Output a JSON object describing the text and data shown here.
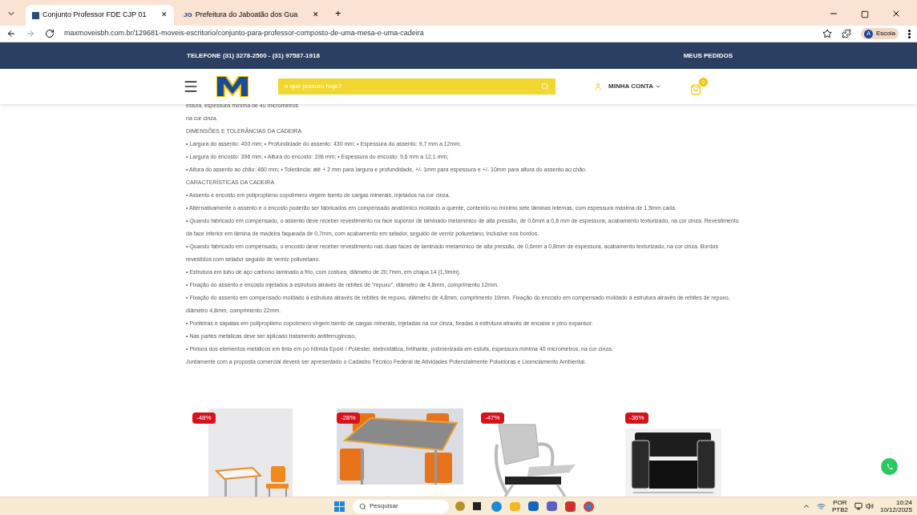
{
  "browser": {
    "tabs": [
      {
        "title": "Conjunto Professor FDE CJP 01",
        "close": "✕",
        "selected": true
      },
      {
        "favicon": "JG",
        "title": "Prefeitura do Jaboatão dos Gua",
        "close": "✕",
        "selected": false
      }
    ],
    "new_tab": "+",
    "url": "maxmoveisbh.com.br/129681-moveis-escritorio/conjunto-para-professor-composto-de-uma-mesa-e-uma-cadeira",
    "profile": {
      "initial": "A",
      "name": "Escola"
    }
  },
  "top_bar": {
    "phone": "TELEFONE (31) 3278-2500 - (31) 97587-1918",
    "orders": "MEUS PEDIDOS"
  },
  "header": {
    "search_placeholder": "o que procuro hoje?",
    "account": "MINHA CONTA",
    "cart_count": "0"
  },
  "description": [
    "estufa, espessura mínima de 40 micrometros",
    "na cor cinza.",
    "DIMENSÕES E TOLERÂNCIAS DA CADEIRA",
    "• Largura do assento: 400 mm; • Profundidade do assento: 430 mm; • Espessura do assento: 9,7 mm a 12mm;",
    "• Largura do encosto: 396 mm; • Altura do encosto: 198 mm; • Espessura do encosto: 9,6 mm a 12,1 mm;",
    "• Altura do assento ao chão: 460 mm; • Tolerância: até + 2 mm para largura e profundidade, +/- 1mm para espessura e +/- 10mm para altura do assento ao chão.",
    "CARACTERÍSTICAS DA CADEIRA",
    "• Assento e encosto em polipropileno copolímero virgem isento de cargas minerais, injetados na cor cinza.",
    "• Alternativamente o assento e o encosto poderão ser fabricados em compensado anatômico moldado a quente, contendo no mínimo sete lâminas internas, com espessura máxima de 1,5mm cada.",
    "• Quando fabricado em compensado, o assento deve receber revestimento na face superior de laminado melamínico de alta pressão, de 0,6mm a 0,8 mm de espessura, acabamento texturizado, na cor cinza. Revestimento da face inferior em lâmina de madeira faqueada de 0,7mm, com acabamento em selador, seguido de verniz poliuretano, inclusive nos bordos.",
    "• Quando fabricado em compensado, o encosto deve receber revestimento nas duas faces de laminado melamínico de alta pressão, de 0,6mm a 0,8mm de espessura, acabamento texturizado, na cor cinza. Bordos revestidos com selador seguido de verniz poliuretano.",
    "• Estrutura em tubo de aço carbono laminado a frio, com costura, diâmetro de 20,7mm, em chapa 14 (1,9mm).",
    "• Fixação do assento e encosto injetados à estrutura através de rebites de “repuxo”, diâmetro de 4,8mm, comprimento 12mm.",
    "• Fixação do assento em compensado moldado à estrutura através de rebites de repuxo, diâmetro de 4,8mm, comprimento 19mm. Fixação do encosto em compensado moldado à estrutura através de rebites de repuxo, diâmetro 4,8mm, comprimento 22mm.",
    "• Ponteiras e sapatas em polipropileno copolímero virgem isento de cargas minerais, injetadas na cor cinza, fixadas à estrutura através de encaixe e pino expansor.",
    "• Nas partes metálicas deve ser aplicado tratamento antiferruginoso,",
    "• Pintura dos elementos metálicos em tinta em pó híbrida Epóxi / Poliéster, eletrostática, brilhante, polimerizada em estufa, espessura mínima 40 micrometros, na cor cinza.",
    "Juntamente com a proposta comercial deverá ser apresentado o Cadastro Técnico Federal de Atividades Potencialmente Poluidoras e Licenciamento Ambiental."
  ],
  "products": [
    {
      "discount": "-48%",
      "kind": "desk"
    },
    {
      "discount": "-28%",
      "kind": "table"
    },
    {
      "discount": "-47%",
      "kind": "bench"
    },
    {
      "discount": "-36%",
      "kind": "armchair"
    }
  ],
  "taskbar": {
    "search_placeholder": "Pesquisar",
    "language": "POR",
    "layout": "PTB2",
    "time": "10:24",
    "date": "10/12/2025"
  }
}
